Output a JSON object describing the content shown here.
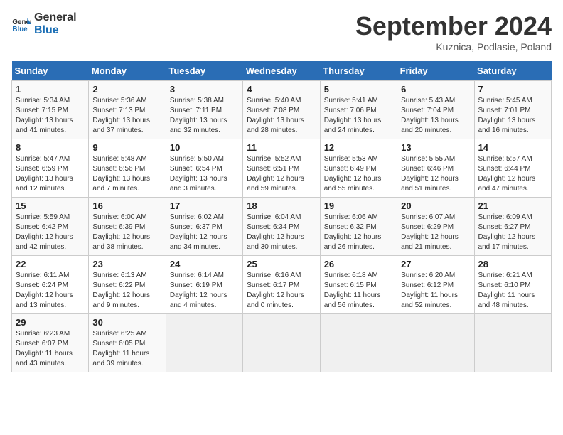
{
  "header": {
    "logo_line1": "General",
    "logo_line2": "Blue",
    "month": "September 2024",
    "location": "Kuznica, Podlasie, Poland"
  },
  "days_of_week": [
    "Sunday",
    "Monday",
    "Tuesday",
    "Wednesday",
    "Thursday",
    "Friday",
    "Saturday"
  ],
  "weeks": [
    [
      {
        "day": "1",
        "info": "Sunrise: 5:34 AM\nSunset: 7:15 PM\nDaylight: 13 hours\nand 41 minutes."
      },
      {
        "day": "2",
        "info": "Sunrise: 5:36 AM\nSunset: 7:13 PM\nDaylight: 13 hours\nand 37 minutes."
      },
      {
        "day": "3",
        "info": "Sunrise: 5:38 AM\nSunset: 7:11 PM\nDaylight: 13 hours\nand 32 minutes."
      },
      {
        "day": "4",
        "info": "Sunrise: 5:40 AM\nSunset: 7:08 PM\nDaylight: 13 hours\nand 28 minutes."
      },
      {
        "day": "5",
        "info": "Sunrise: 5:41 AM\nSunset: 7:06 PM\nDaylight: 13 hours\nand 24 minutes."
      },
      {
        "day": "6",
        "info": "Sunrise: 5:43 AM\nSunset: 7:04 PM\nDaylight: 13 hours\nand 20 minutes."
      },
      {
        "day": "7",
        "info": "Sunrise: 5:45 AM\nSunset: 7:01 PM\nDaylight: 13 hours\nand 16 minutes."
      }
    ],
    [
      {
        "day": "8",
        "info": "Sunrise: 5:47 AM\nSunset: 6:59 PM\nDaylight: 13 hours\nand 12 minutes."
      },
      {
        "day": "9",
        "info": "Sunrise: 5:48 AM\nSunset: 6:56 PM\nDaylight: 13 hours\nand 7 minutes."
      },
      {
        "day": "10",
        "info": "Sunrise: 5:50 AM\nSunset: 6:54 PM\nDaylight: 13 hours\nand 3 minutes."
      },
      {
        "day": "11",
        "info": "Sunrise: 5:52 AM\nSunset: 6:51 PM\nDaylight: 12 hours\nand 59 minutes."
      },
      {
        "day": "12",
        "info": "Sunrise: 5:53 AM\nSunset: 6:49 PM\nDaylight: 12 hours\nand 55 minutes."
      },
      {
        "day": "13",
        "info": "Sunrise: 5:55 AM\nSunset: 6:46 PM\nDaylight: 12 hours\nand 51 minutes."
      },
      {
        "day": "14",
        "info": "Sunrise: 5:57 AM\nSunset: 6:44 PM\nDaylight: 12 hours\nand 47 minutes."
      }
    ],
    [
      {
        "day": "15",
        "info": "Sunrise: 5:59 AM\nSunset: 6:42 PM\nDaylight: 12 hours\nand 42 minutes."
      },
      {
        "day": "16",
        "info": "Sunrise: 6:00 AM\nSunset: 6:39 PM\nDaylight: 12 hours\nand 38 minutes."
      },
      {
        "day": "17",
        "info": "Sunrise: 6:02 AM\nSunset: 6:37 PM\nDaylight: 12 hours\nand 34 minutes."
      },
      {
        "day": "18",
        "info": "Sunrise: 6:04 AM\nSunset: 6:34 PM\nDaylight: 12 hours\nand 30 minutes."
      },
      {
        "day": "19",
        "info": "Sunrise: 6:06 AM\nSunset: 6:32 PM\nDaylight: 12 hours\nand 26 minutes."
      },
      {
        "day": "20",
        "info": "Sunrise: 6:07 AM\nSunset: 6:29 PM\nDaylight: 12 hours\nand 21 minutes."
      },
      {
        "day": "21",
        "info": "Sunrise: 6:09 AM\nSunset: 6:27 PM\nDaylight: 12 hours\nand 17 minutes."
      }
    ],
    [
      {
        "day": "22",
        "info": "Sunrise: 6:11 AM\nSunset: 6:24 PM\nDaylight: 12 hours\nand 13 minutes."
      },
      {
        "day": "23",
        "info": "Sunrise: 6:13 AM\nSunset: 6:22 PM\nDaylight: 12 hours\nand 9 minutes."
      },
      {
        "day": "24",
        "info": "Sunrise: 6:14 AM\nSunset: 6:19 PM\nDaylight: 12 hours\nand 4 minutes."
      },
      {
        "day": "25",
        "info": "Sunrise: 6:16 AM\nSunset: 6:17 PM\nDaylight: 12 hours\nand 0 minutes."
      },
      {
        "day": "26",
        "info": "Sunrise: 6:18 AM\nSunset: 6:15 PM\nDaylight: 11 hours\nand 56 minutes."
      },
      {
        "day": "27",
        "info": "Sunrise: 6:20 AM\nSunset: 6:12 PM\nDaylight: 11 hours\nand 52 minutes."
      },
      {
        "day": "28",
        "info": "Sunrise: 6:21 AM\nSunset: 6:10 PM\nDaylight: 11 hours\nand 48 minutes."
      }
    ],
    [
      {
        "day": "29",
        "info": "Sunrise: 6:23 AM\nSunset: 6:07 PM\nDaylight: 11 hours\nand 43 minutes."
      },
      {
        "day": "30",
        "info": "Sunrise: 6:25 AM\nSunset: 6:05 PM\nDaylight: 11 hours\nand 39 minutes."
      },
      {
        "day": "",
        "info": ""
      },
      {
        "day": "",
        "info": ""
      },
      {
        "day": "",
        "info": ""
      },
      {
        "day": "",
        "info": ""
      },
      {
        "day": "",
        "info": ""
      }
    ]
  ]
}
